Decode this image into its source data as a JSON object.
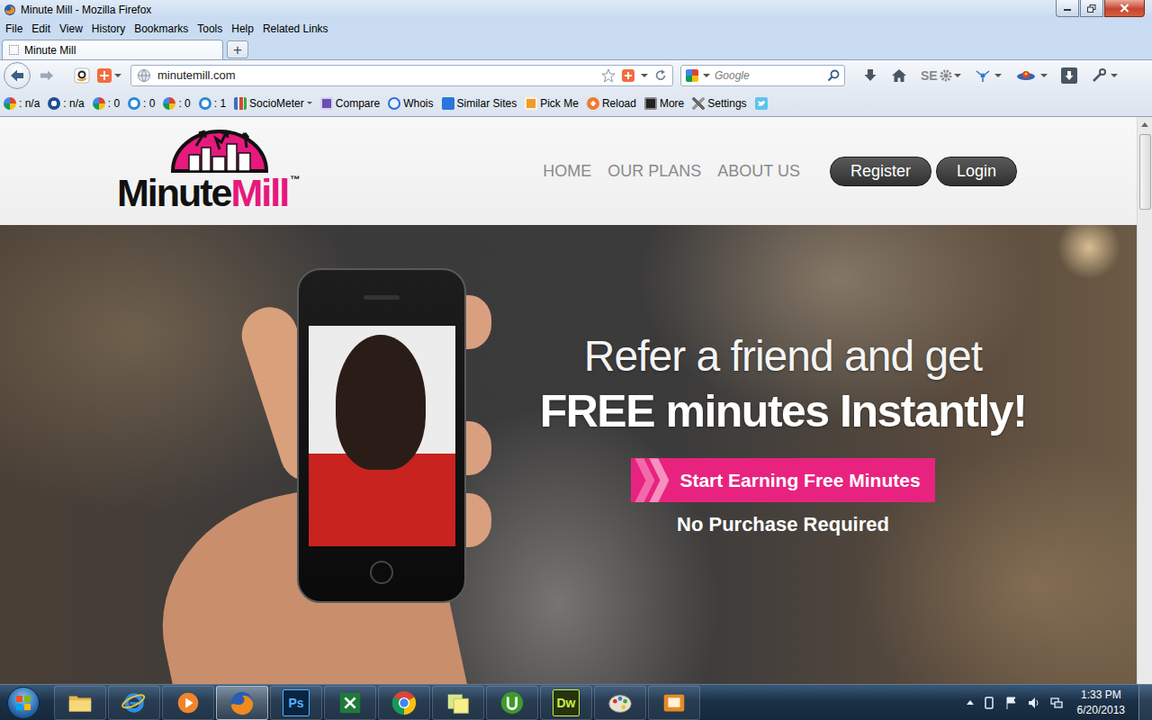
{
  "window": {
    "title": "Minute Mill - Mozilla Firefox"
  },
  "menu": [
    "File",
    "Edit",
    "View",
    "History",
    "Bookmarks",
    "Tools",
    "Help",
    "Related Links"
  ],
  "tabs": [
    {
      "label": "Minute Mill",
      "selected": true
    }
  ],
  "new_tab": "+",
  "address": "minutemill.com",
  "search": {
    "placeholder": "Google"
  },
  "toolbar_badge": "SE",
  "bookmarks": [
    {
      "kind": "google",
      "label": ": n/a",
      "menu": false
    },
    {
      "kind": "alexa",
      "label": ": n/a",
      "menu": false
    },
    {
      "kind": "google",
      "label": ": 0",
      "menu": false
    },
    {
      "kind": "bing",
      "label": ": 0",
      "menu": false
    },
    {
      "kind": "google",
      "label": ": 0",
      "menu": false
    },
    {
      "kind": "bing",
      "label": ": 1",
      "menu": false
    },
    {
      "kind": "chart",
      "label": "SocioMeter",
      "menu": true
    },
    {
      "kind": "compare",
      "label": "Compare",
      "menu": false
    },
    {
      "kind": "help",
      "label": "Whois",
      "menu": false
    },
    {
      "kind": "similar",
      "label": "Similar Sites",
      "menu": false
    },
    {
      "kind": "pickme",
      "label": "Pick Me",
      "menu": false
    },
    {
      "kind": "reload",
      "label": "Reload",
      "menu": false
    },
    {
      "kind": "wr",
      "label": "More",
      "menu": false
    },
    {
      "kind": "tools",
      "label": "Settings",
      "menu": false
    }
  ],
  "site": {
    "logo": {
      "first": "Minute",
      "second": "Mill",
      "mark": "™"
    },
    "nav": [
      "HOME",
      "OUR PLANS",
      "ABOUT US"
    ],
    "buttons": [
      "Register",
      "Login"
    ]
  },
  "hero": {
    "line1": "Refer a friend and get",
    "line2": "FREE minutes Instantly!",
    "cta": "Start Earning Free Minutes",
    "note": "No Purchase Required"
  },
  "taskbar": {
    "apps": [
      {
        "kind": "explorer",
        "badge": "",
        "selected": false
      },
      {
        "kind": "ie",
        "badge": "",
        "selected": false
      },
      {
        "kind": "media",
        "badge": "",
        "selected": false
      },
      {
        "kind": "firefox",
        "badge": "",
        "selected": true
      },
      {
        "kind": "photoshop",
        "badge": "Ps",
        "selected": false
      },
      {
        "kind": "excel",
        "badge": "",
        "selected": false
      },
      {
        "kind": "chrome",
        "badge": "",
        "selected": false
      },
      {
        "kind": "notes",
        "badge": "",
        "selected": false
      },
      {
        "kind": "utorrent",
        "badge": "",
        "selected": false
      },
      {
        "kind": "dreamweaver",
        "badge": "Dw",
        "selected": false
      },
      {
        "kind": "paint",
        "badge": "",
        "selected": false
      },
      {
        "kind": "slides",
        "badge": "",
        "selected": false
      }
    ],
    "clock": {
      "time": "1:33 PM",
      "date": "6/20/2013"
    }
  }
}
